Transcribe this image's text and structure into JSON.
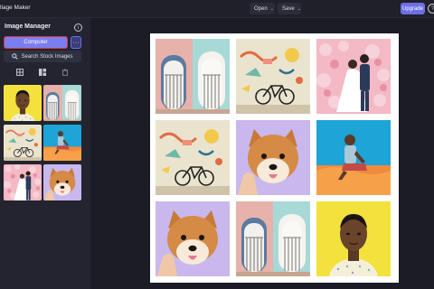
{
  "header": {
    "app_title": "llage Maker",
    "open_label": "Open",
    "save_label": "Save",
    "upgrade_label": "Upgrade",
    "caret": "⌄",
    "help_glyph": "?"
  },
  "sidebar": {
    "title": "Image Manager",
    "info_glyph": "i",
    "computer_label": "Computer",
    "more_label": "···",
    "stock_label": "Search Stock Images"
  },
  "icons": [
    "info-icon",
    "more-icon",
    "search-icon",
    "layout-grid-icon",
    "layout-mosaic-icon",
    "trash-icon",
    "help-icon"
  ],
  "thumbnails": [
    "woman-yellow-background",
    "pastel-doors",
    "cyclist-mural",
    "man-sitting-orange",
    "couple-flower-wall",
    "shiba-inu-dog"
  ],
  "collage": [
    "pastel-doors",
    "cyclist-mural",
    "couple-flower-wall",
    "cyclist-mural",
    "shiba-inu-dog",
    "man-sitting-orange",
    "shiba-inu-dog",
    "pastel-doors",
    "woman-yellow-background"
  ],
  "colors": {
    "accent": "#7b7ef0",
    "highlight_border": "#d8383d",
    "upgrade": "#6c6fe6",
    "canvas_bg": "#ffffff",
    "workspace_bg": "#1b1c25"
  }
}
